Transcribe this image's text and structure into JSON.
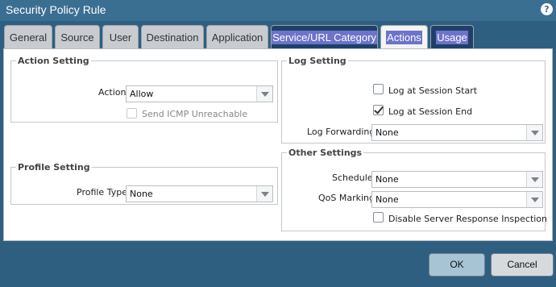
{
  "window": {
    "title": "Security Policy Rule",
    "help_icon": "help-icon"
  },
  "tabs": [
    {
      "label": "General",
      "state": "normal"
    },
    {
      "label": "Source",
      "state": "normal"
    },
    {
      "label": "User",
      "state": "normal"
    },
    {
      "label": "Destination",
      "state": "normal"
    },
    {
      "label": "Application",
      "state": "normal"
    },
    {
      "label": "Service/URL Category",
      "state": "highlighted"
    },
    {
      "label": "Actions",
      "state": "active"
    },
    {
      "label": "Usage",
      "state": "highlighted"
    }
  ],
  "action_setting": {
    "legend": "Action Setting",
    "action_label": "Action",
    "action_value": "Allow",
    "icmp_label": "Send ICMP Unreachable",
    "icmp_checked": false,
    "icmp_disabled": true
  },
  "profile_setting": {
    "legend": "Profile Setting",
    "profile_type_label": "Profile Type",
    "profile_type_value": "None"
  },
  "log_setting": {
    "legend": "Log Setting",
    "session_start_label": "Log at Session Start",
    "session_start_checked": false,
    "session_end_label": "Log at Session End",
    "session_end_checked": true,
    "forwarding_label": "Log Forwarding",
    "forwarding_value": "None"
  },
  "other_settings": {
    "legend": "Other Settings",
    "schedule_label": "Schedule",
    "schedule_value": "None",
    "qos_label": "QoS Marking",
    "qos_value": "None",
    "disable_inspection_label": "Disable Server Response Inspection",
    "disable_inspection_checked": false
  },
  "buttons": {
    "ok": "OK",
    "cancel": "Cancel"
  },
  "colors": {
    "title_bar": "#3a6f92",
    "highlight": "#6c73c9",
    "ok_button": "#a7c4d4"
  }
}
